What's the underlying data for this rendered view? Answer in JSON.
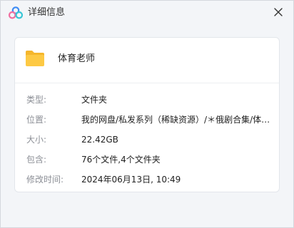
{
  "window": {
    "title": "详细信息"
  },
  "folder": {
    "name": "体育老师"
  },
  "details": [
    {
      "label": "类型:",
      "value": "文件夹"
    },
    {
      "label": "位置:",
      "value": "我的网盘/私发系列（稀缺资源）/＊俄剧合集/体育老师"
    },
    {
      "label": "大小:",
      "value": "22.42GB"
    },
    {
      "label": "包含:",
      "value": "76个文件,4个文件夹"
    },
    {
      "label": "修改时间:",
      "value": "2024年06月13日, 10:49"
    }
  ],
  "colors": {
    "logo_pink": "#f06fa0",
    "logo_blue": "#3d8cf5",
    "logo_teal": "#38c6d6",
    "folder_yellow": "#fdc944",
    "folder_tab": "#f5b62c"
  },
  "icons": {
    "app_logo": "baidu-netdisk-logo",
    "close": "close-icon",
    "folder": "folder-icon"
  }
}
